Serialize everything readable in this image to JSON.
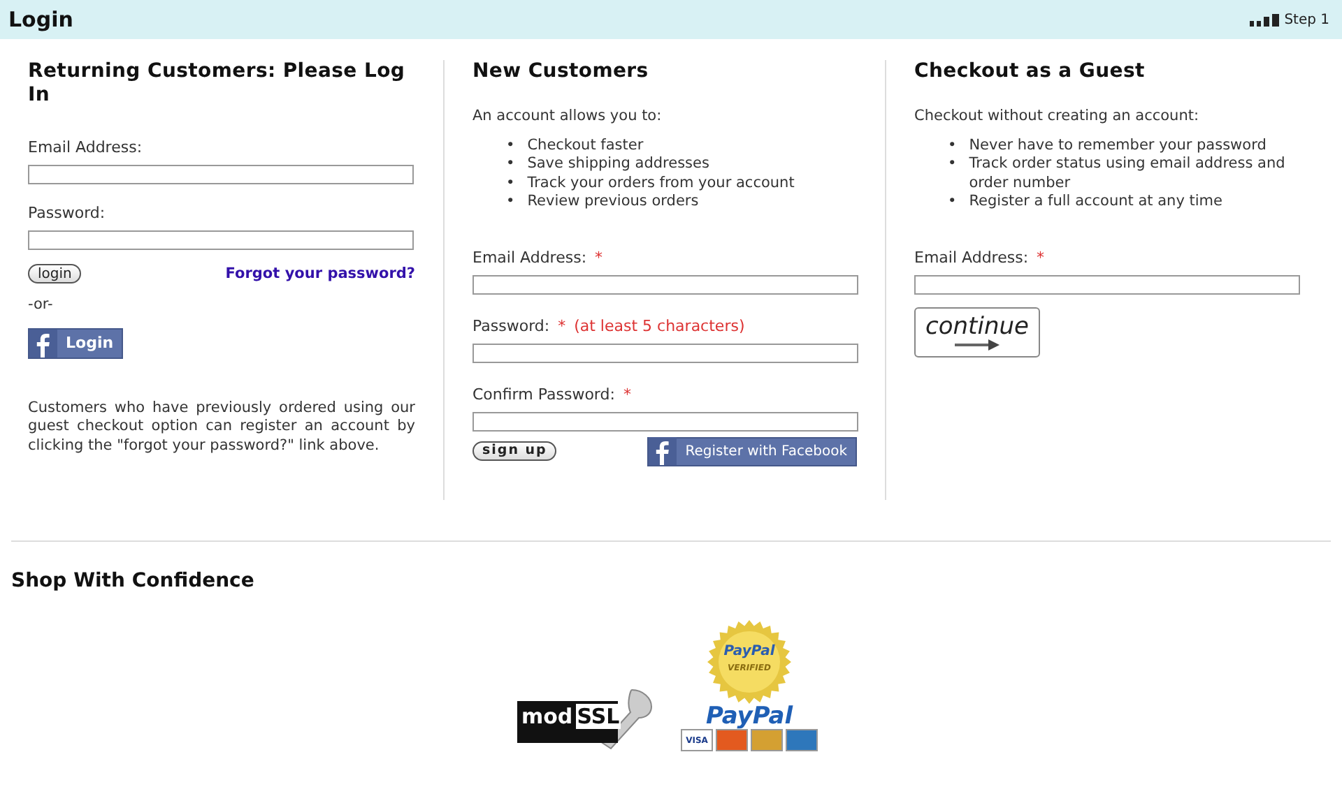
{
  "header": {
    "title": "Login",
    "step": "Step 1"
  },
  "returning": {
    "heading": "Returning Customers: Please Log In",
    "fields": [
      {
        "label": "Email Address:"
      },
      {
        "label": "Password:"
      }
    ],
    "login_button": "login",
    "forgot_link": "Forgot your password?",
    "or": "-or-",
    "facebook_button": "Login",
    "note": "Customers who have previously ordered using our guest checkout option can register an account by clicking the \"forgot your password?\" link above."
  },
  "new_customers": {
    "heading": "New Customers",
    "intro": "An account allows you to:",
    "bullet": "•",
    "benefits": [
      "Checkout faster",
      "Save shipping addresses",
      "Track your orders from your account",
      "Review previous orders"
    ],
    "fields": [
      {
        "label": "Email Address:",
        "required_mark": "*"
      },
      {
        "label": "Password:",
        "required_mark": "*",
        "hint": "(at least 5 characters)"
      },
      {
        "label": "Confirm Password:",
        "required_mark": "*"
      }
    ],
    "signup_button": "sign up",
    "facebook_button": "Register with Facebook"
  },
  "guest": {
    "heading": "Checkout as a Guest",
    "intro": "Checkout without creating an account:",
    "bullet": "•",
    "benefits": [
      "Never have to remember your password",
      "Track order status using email address and order number",
      "Register a full account at any time"
    ],
    "fields": [
      {
        "label": "Email Address:",
        "required_mark": "*"
      }
    ],
    "continue_button": "continue"
  },
  "confidence": {
    "heading": "Shop With Confidence",
    "ssl_badge": {
      "word_1": "mod",
      "word_2": "SSL"
    },
    "paypal_badge": {
      "seal_word": "PayPal",
      "seal_caption": "VERIFIED",
      "wordmark": "PayPal",
      "card_label": "VISA"
    }
  }
}
